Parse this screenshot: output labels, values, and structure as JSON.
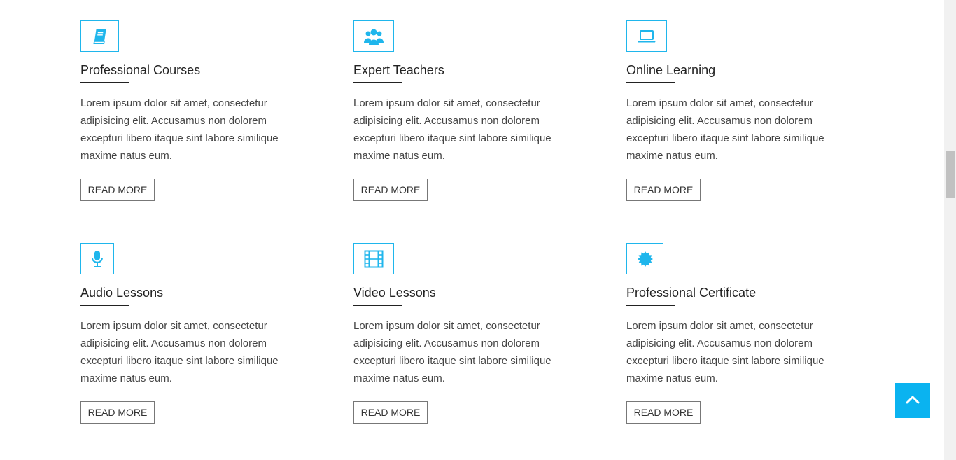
{
  "colors": {
    "accent": "#1fb6ec",
    "back_to_top": "#0ab3f0",
    "title": "#222222",
    "body_text": "#444444"
  },
  "features": [
    {
      "icon": "book-icon",
      "title": "Professional Courses",
      "text": "Lorem ipsum dolor sit amet, consectetur adipisicing elit. Accusamus non dolorem excepturi libero itaque sint labore similique maxime natus eum.",
      "button": "READ MORE"
    },
    {
      "icon": "users-icon",
      "title": "Expert Teachers",
      "text": "Lorem ipsum dolor sit amet, consectetur adipisicing elit. Accusamus non dolorem excepturi libero itaque sint labore similique maxime natus eum.",
      "button": "READ MORE"
    },
    {
      "icon": "laptop-icon",
      "title": "Online Learning",
      "text": "Lorem ipsum dolor sit amet, consectetur adipisicing elit. Accusamus non dolorem excepturi libero itaque sint labore similique maxime natus eum.",
      "button": "READ MORE"
    },
    {
      "icon": "microphone-icon",
      "title": "Audio Lessons",
      "text": "Lorem ipsum dolor sit amet, consectetur adipisicing elit. Accusamus non dolorem excepturi libero itaque sint labore similique maxime natus eum.",
      "button": "READ MORE"
    },
    {
      "icon": "film-icon",
      "title": "Video Lessons",
      "text": "Lorem ipsum dolor sit amet, consectetur adipisicing elit. Accusamus non dolorem excepturi libero itaque sint labore similique maxime natus eum.",
      "button": "READ MORE"
    },
    {
      "icon": "certificate-icon",
      "title": "Professional Certificate",
      "text": "Lorem ipsum dolor sit amet, consectetur adipisicing elit. Accusamus non dolorem excepturi libero itaque sint labore similique maxime natus eum.",
      "button": "READ MORE"
    }
  ],
  "back_to_top_icon": "chevron-up-icon"
}
